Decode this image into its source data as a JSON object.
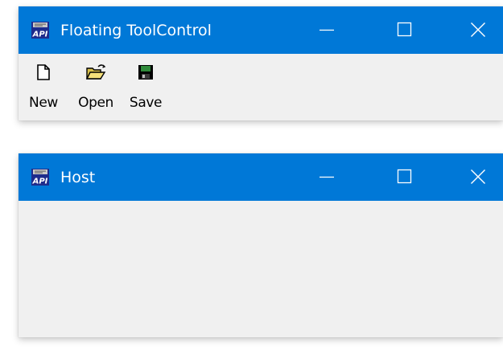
{
  "colors": {
    "titlebar": "#0078d7",
    "client_background": "#f0f0f0",
    "title_text": "#ffffff"
  },
  "windows": [
    {
      "title": "Floating ToolControl",
      "app_icon": "api-app-icon",
      "toolbar": {
        "items": [
          {
            "label": "New",
            "icon": "new-document-icon"
          },
          {
            "label": "Open",
            "icon": "open-folder-icon"
          },
          {
            "label": "Save",
            "icon": "save-floppy-icon"
          }
        ]
      }
    },
    {
      "title": "Host",
      "app_icon": "api-app-icon"
    }
  ]
}
